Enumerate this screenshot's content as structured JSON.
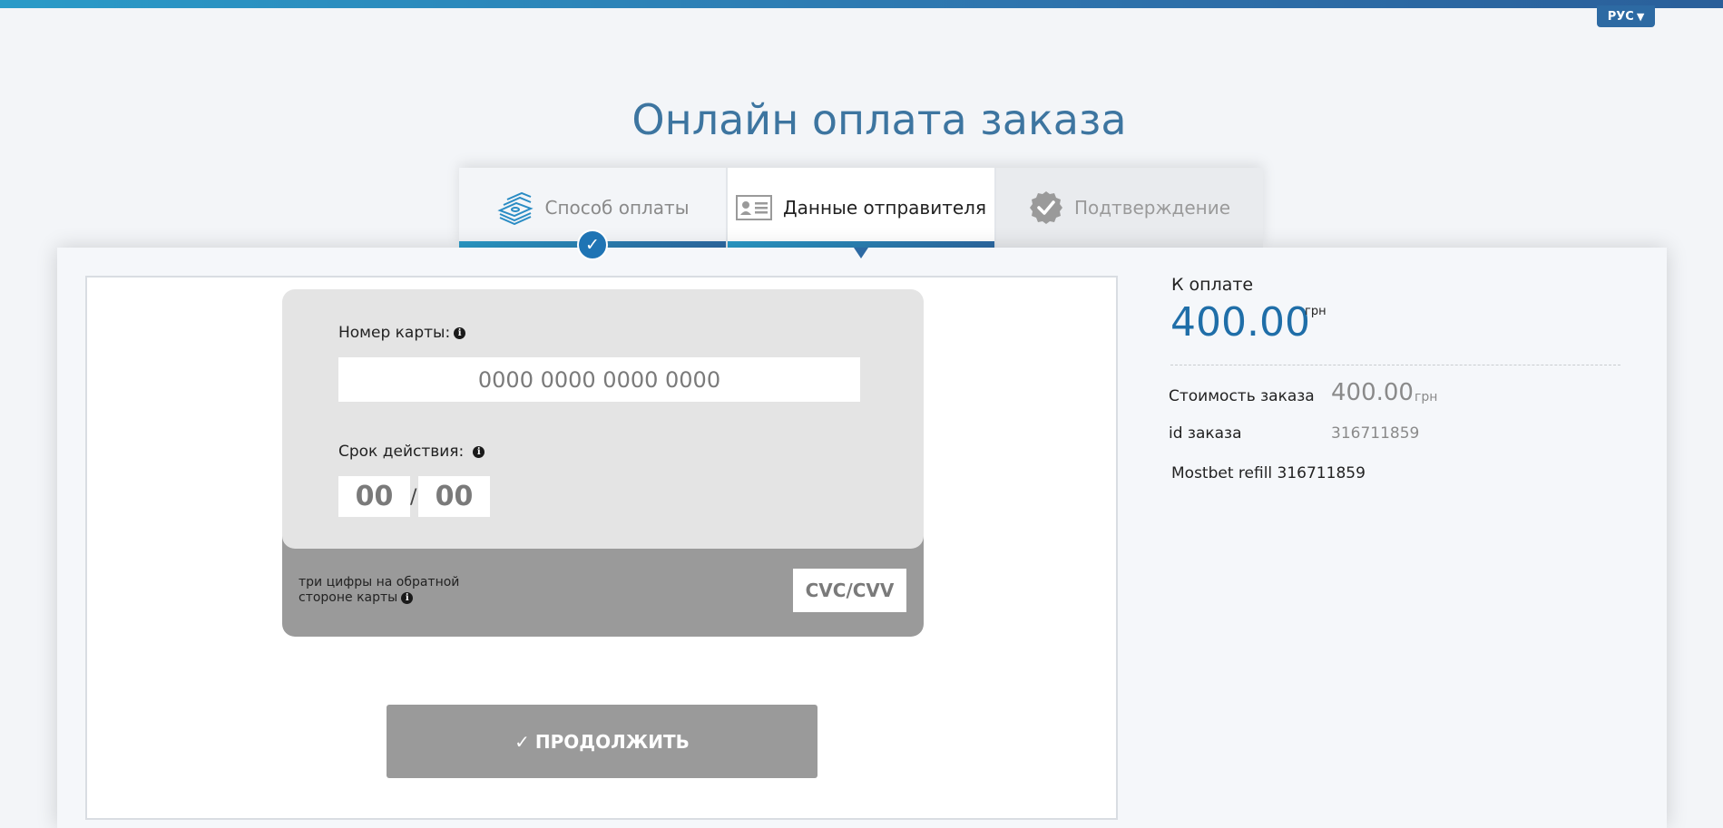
{
  "header": {
    "language": "РУС",
    "title": "Онлайн оплата заказа"
  },
  "steps": [
    {
      "label": "Способ оплаты",
      "state": "done",
      "icon": "money-stack-icon"
    },
    {
      "label": "Данные отправителя",
      "state": "active",
      "icon": "id-card-icon"
    },
    {
      "label": "Подтверждение",
      "state": "pending",
      "icon": "check-badge-icon"
    }
  ],
  "form": {
    "card_number_label": "Номер карты:",
    "card_number_placeholder": "0000 0000 0000 0000",
    "expiry_label": "Срок действия:",
    "expiry_month_placeholder": "00",
    "expiry_separator": "/",
    "expiry_year_placeholder": "00",
    "cvc_hint_line1": "три цифры на обратной",
    "cvc_hint_line2": "стороне карты",
    "cvc_placeholder": "CVC/CVV",
    "continue_label": "ПРОДОЛЖИТЬ"
  },
  "summary": {
    "title": "К оплате",
    "amount": "400.00",
    "currency": "грн",
    "cost_label": "Стоимость заказа",
    "cost_value": "400.00",
    "cost_currency": "грн",
    "order_id_label": "id заказа",
    "order_id_value": "316711859",
    "description": "Mostbet refill 316711859"
  },
  "colors": {
    "accent": "#1f6ea8",
    "title": "#3d75a0",
    "button_disabled": "#9a9a9a"
  }
}
